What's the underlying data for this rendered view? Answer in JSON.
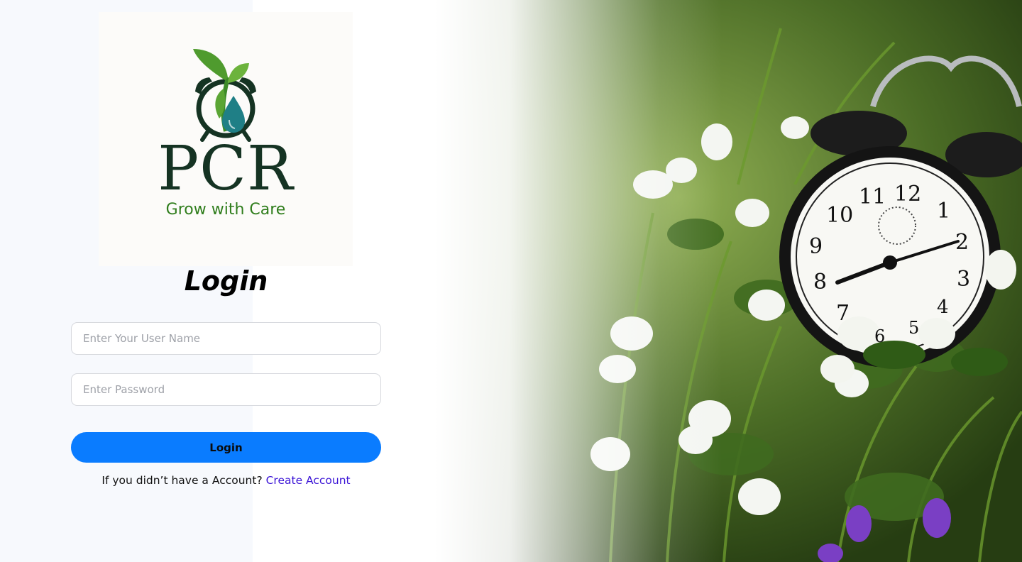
{
  "brand": {
    "name": "PCR",
    "tagline": "Grow with Care"
  },
  "form": {
    "title": "Login",
    "username_placeholder": "Enter Your User Name",
    "password_placeholder": "Enter Password",
    "login_button": "Login",
    "signup_prompt": "If you didn’t have a Account?",
    "signup_link": "Create Account"
  },
  "clock": {
    "numerals": [
      "12",
      "1",
      "2",
      "3",
      "4",
      "5",
      "6",
      "7",
      "8",
      "9",
      "10",
      "11"
    ]
  },
  "colors": {
    "primary_button": "#0a7cff",
    "brand_dark_green": "#153323",
    "brand_green": "#2f7d1c",
    "link": "#3b14d6"
  },
  "icons": {
    "logo": "sprout-alarm-clock-logo"
  }
}
